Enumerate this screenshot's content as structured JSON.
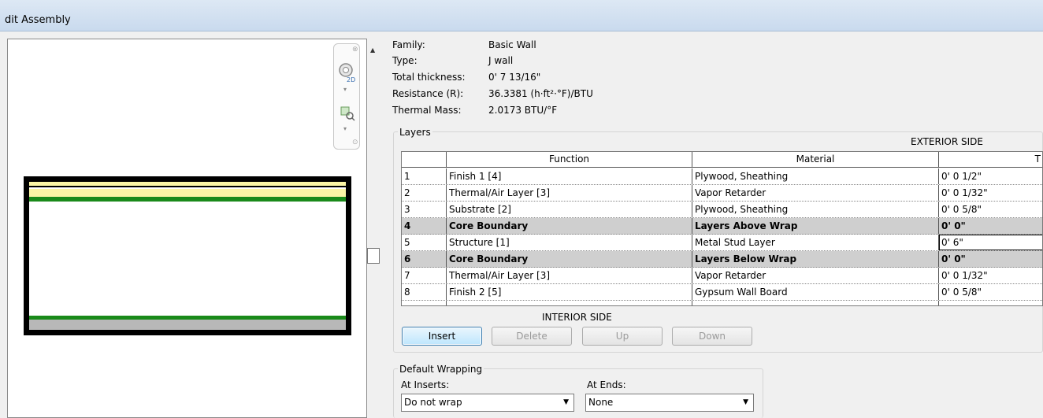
{
  "window": {
    "title": "dit Assembly"
  },
  "properties": [
    {
      "label": "Family:",
      "value": "Basic Wall"
    },
    {
      "label": "Type:",
      "value": "J wall"
    },
    {
      "label": "Total thickness:",
      "value": "0'  7 13/16\""
    },
    {
      "label": "Resistance (R):",
      "value": "36.3381 (h·ft²·°F)/BTU"
    },
    {
      "label": "Thermal Mass:",
      "value": "2.0173 BTU/°F"
    }
  ],
  "layers": {
    "group_title": "Layers",
    "exterior_label": "EXTERIOR SIDE",
    "interior_label": "INTERIOR SIDE",
    "columns": {
      "number": "",
      "function": "Function",
      "material": "Material",
      "thickness": "T"
    },
    "rows": [
      {
        "num": "1",
        "function": "Finish 1 [4]",
        "material": "Plywood, Sheathing",
        "thickness": "0'  0 1/2\"",
        "core": false
      },
      {
        "num": "2",
        "function": "Thermal/Air Layer [3]",
        "material": "Vapor Retarder",
        "thickness": "0'  0 1/32\"",
        "core": false
      },
      {
        "num": "3",
        "function": "Substrate [2]",
        "material": "Plywood, Sheathing",
        "thickness": "0'  0 5/8\"",
        "core": false
      },
      {
        "num": "4",
        "function": "Core Boundary",
        "material": "Layers Above Wrap",
        "thickness": "0'  0\"",
        "core": true
      },
      {
        "num": "5",
        "function": "Structure [1]",
        "material": "Metal Stud Layer",
        "thickness": "0'  6\"",
        "core": false
      },
      {
        "num": "6",
        "function": "Core Boundary",
        "material": "Layers Below Wrap",
        "thickness": "0'  0\"",
        "core": true
      },
      {
        "num": "7",
        "function": "Thermal/Air Layer [3]",
        "material": "Vapor Retarder",
        "thickness": "0'  0 1/32\"",
        "core": false
      },
      {
        "num": "8",
        "function": "Finish 2 [5]",
        "material": "Gypsum Wall Board",
        "thickness": "0'  0 5/8\"",
        "core": false
      }
    ]
  },
  "buttons": {
    "insert": "Insert",
    "delete": "Delete",
    "up": "Up",
    "down": "Down"
  },
  "wrapping": {
    "group_title": "Default Wrapping",
    "at_inserts_label": "At Inserts:",
    "at_inserts_value": "Do not wrap",
    "at_ends_label": "At Ends:",
    "at_ends_value": "None"
  },
  "colors": {
    "finish_layer": "#fbf5a5",
    "vapor_layer": "#1a8a1a",
    "gypsum_layer": "#b8b8b8",
    "core_row": "#cfcfcf"
  }
}
